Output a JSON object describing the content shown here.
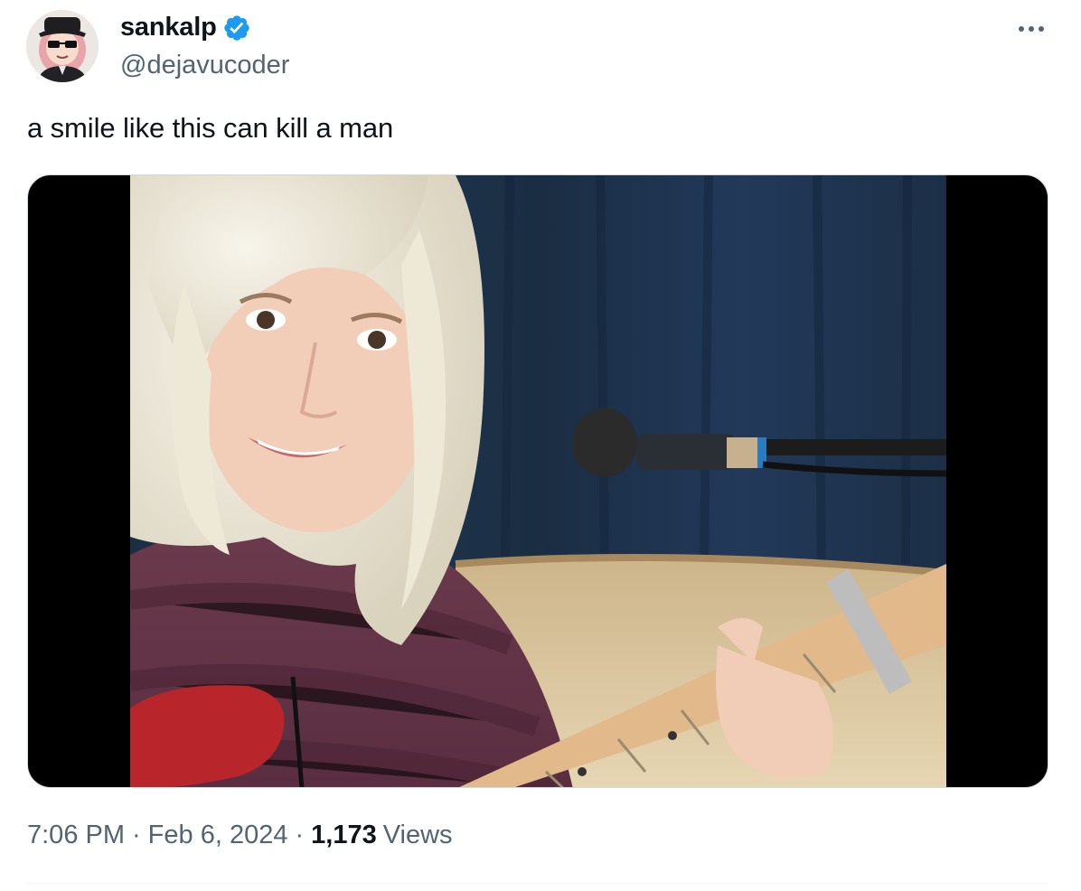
{
  "author": {
    "display_name": "sankalp",
    "handle": "@dejavucoder",
    "verified": true,
    "verified_color": "#1d9bf0",
    "avatar_icon": "cartoon-avatar-with-sunglasses"
  },
  "more_icon": "more-horizontal-icon",
  "tweet": {
    "text": "a smile like this can kill a man"
  },
  "media": {
    "description_icon": "video-frame"
  },
  "meta": {
    "time": "7:06 PM",
    "separator1": "·",
    "date": "Feb 6, 2024",
    "separator2": "·",
    "views_count": "1,173",
    "views_label": "Views"
  },
  "colors": {
    "text_primary": "#0f1419",
    "text_secondary": "#536471",
    "border": "#cfd9de",
    "divider": "#eff3f4"
  }
}
